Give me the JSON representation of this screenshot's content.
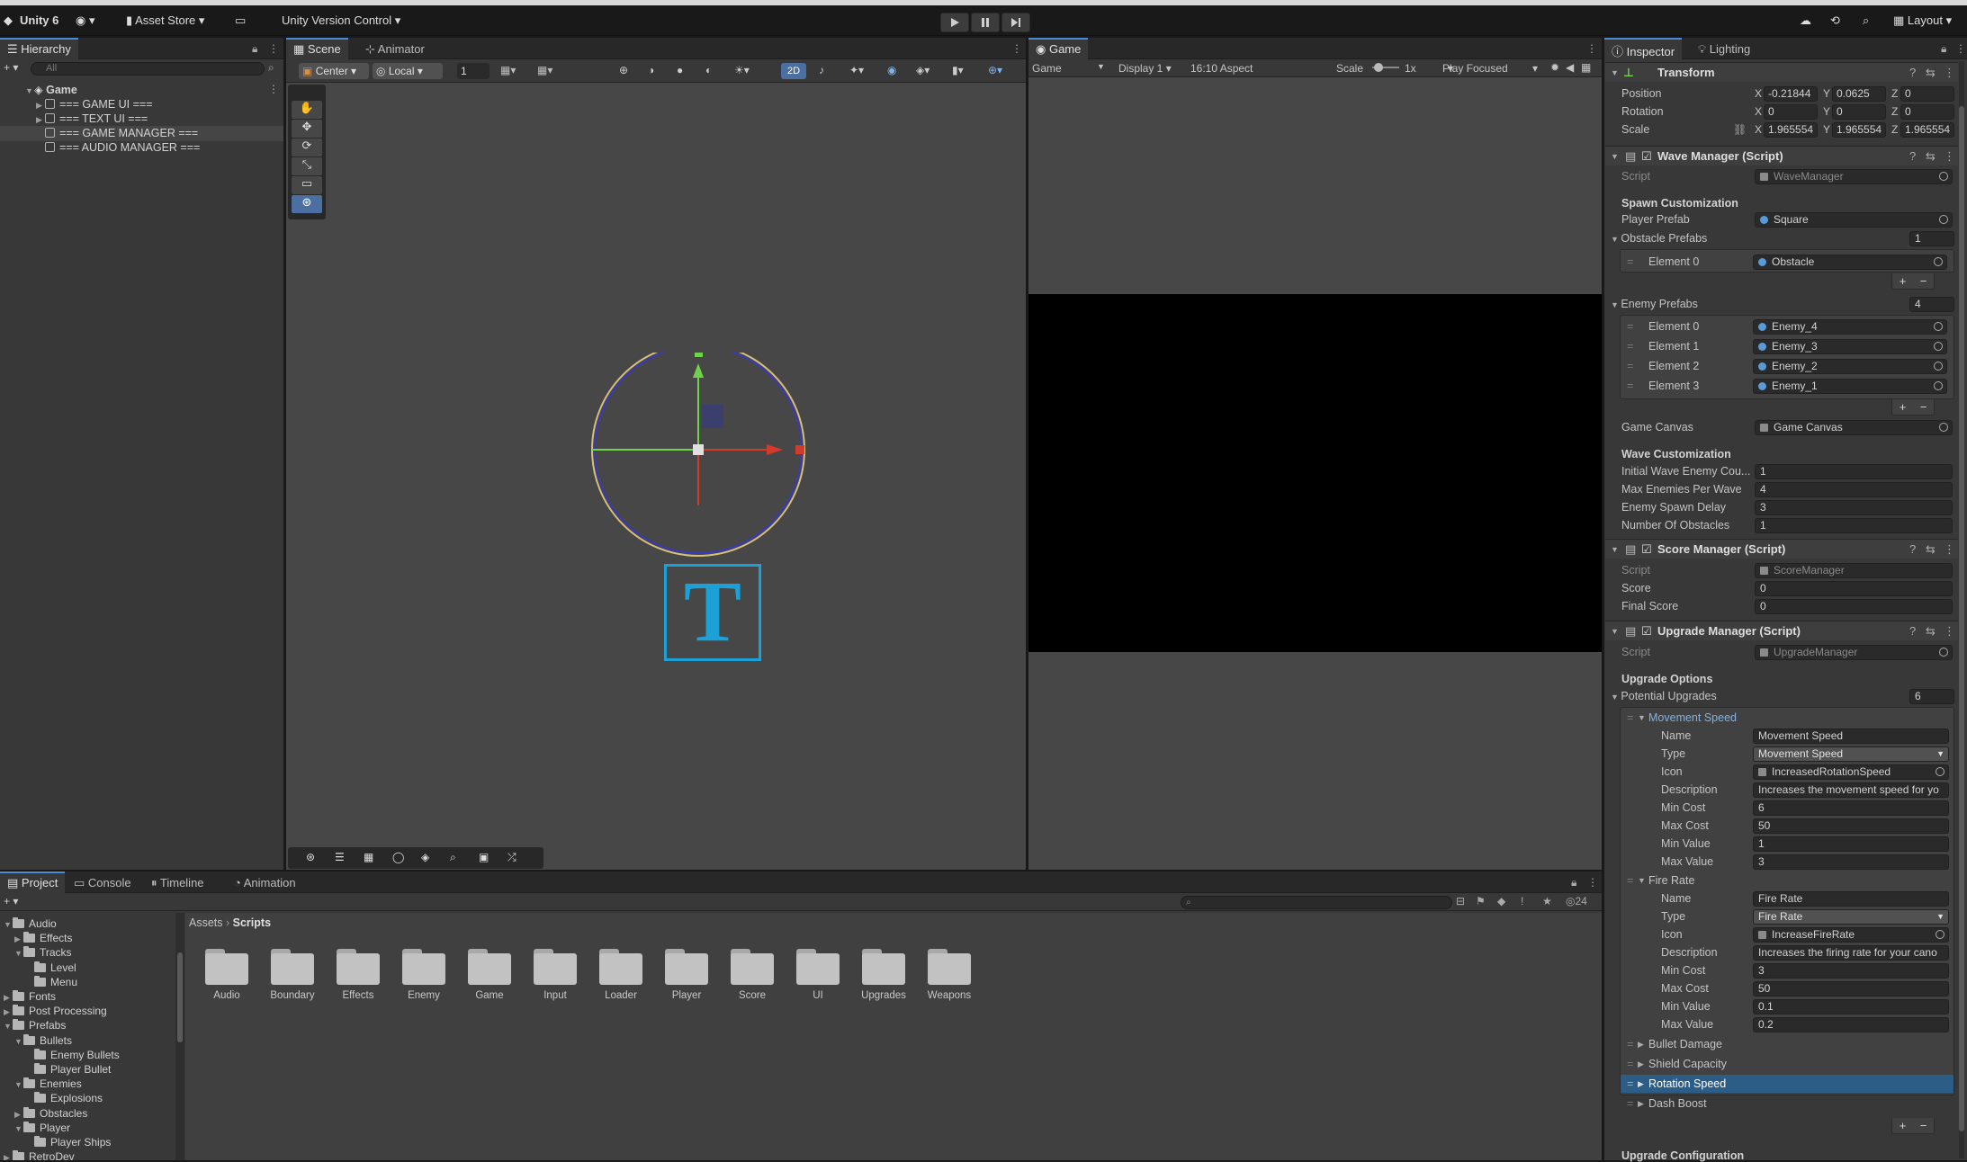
{
  "topbar": {
    "app": "Unity 6",
    "asset_store": "Asset Store",
    "version_control": "Unity Version Control",
    "layout": "Layout"
  },
  "hierarchy": {
    "tab": "Hierarchy",
    "search_placeholder": "All",
    "scene": "Game",
    "items": [
      "=== GAME UI ===",
      "=== TEXT UI ===",
      "=== GAME MANAGER ===",
      "=== AUDIO MANAGER ==="
    ]
  },
  "scene_view": {
    "tabs": [
      "Scene",
      "Animator"
    ],
    "pivot": "Center",
    "space": "Local",
    "grid_value": "1",
    "mode_2d": "2D",
    "text_tool_glyph": "T"
  },
  "game_view": {
    "tab": "Game",
    "display_mode": "Game",
    "display": "Display 1",
    "aspect": "16:10 Aspect",
    "scale_label": "Scale",
    "scale_value": "1x",
    "play_mode": "Play Focused"
  },
  "bottom": {
    "tabs": [
      "Project",
      "Console",
      "Timeline",
      "Animation"
    ],
    "breadcrumb": [
      "Assets",
      "Scripts"
    ],
    "hidden_count": "24",
    "tree": [
      {
        "label": "Audio",
        "depth": 1,
        "open": true
      },
      {
        "label": "Effects",
        "depth": 2,
        "open": false
      },
      {
        "label": "Tracks",
        "depth": 2,
        "open": true
      },
      {
        "label": "Level",
        "depth": 3,
        "open": false
      },
      {
        "label": "Menu",
        "depth": 3,
        "open": false
      },
      {
        "label": "Fonts",
        "depth": 1,
        "open": false
      },
      {
        "label": "Post Processing",
        "depth": 1,
        "open": false
      },
      {
        "label": "Prefabs",
        "depth": 1,
        "open": true
      },
      {
        "label": "Bullets",
        "depth": 2,
        "open": true
      },
      {
        "label": "Enemy Bullets",
        "depth": 3,
        "open": false
      },
      {
        "label": "Player Bullet",
        "depth": 3,
        "open": false
      },
      {
        "label": "Enemies",
        "depth": 2,
        "open": true
      },
      {
        "label": "Explosions",
        "depth": 3,
        "open": false
      },
      {
        "label": "Obstacles",
        "depth": 2,
        "open": false
      },
      {
        "label": "Player",
        "depth": 2,
        "open": true
      },
      {
        "label": "Player Ships",
        "depth": 3,
        "open": false
      },
      {
        "label": "RetroDev",
        "depth": 1,
        "open": false
      }
    ],
    "folders": [
      "Audio",
      "Boundary",
      "Effects",
      "Enemy",
      "Game",
      "Input",
      "Loader",
      "Player",
      "Score",
      "UI",
      "Upgrades",
      "Weapons"
    ]
  },
  "inspector": {
    "tabs": [
      "Inspector",
      "Lighting"
    ],
    "transform": {
      "title": "Transform",
      "position_label": "Position",
      "position": [
        "-0.21844",
        "0.0625",
        "0"
      ],
      "rotation_label": "Rotation",
      "rotation": [
        "0",
        "0",
        "0"
      ],
      "scale_label": "Scale",
      "scale": [
        "1.965554",
        "1.965554",
        "1.965554"
      ]
    },
    "wave": {
      "title": "Wave Manager (Script)",
      "script_label": "Script",
      "script": "WaveManager",
      "spawn_header": "Spawn Customization",
      "player_prefab_label": "Player Prefab",
      "player_prefab": "Square",
      "obstacle_label": "Obstacle Prefabs",
      "obstacle_count": "1",
      "obstacles": [
        {
          "label": "Element 0",
          "value": "Obstacle"
        }
      ],
      "enemy_label": "Enemy Prefabs",
      "enemy_count": "4",
      "enemies": [
        {
          "label": "Element 0",
          "value": "Enemy_4"
        },
        {
          "label": "Element 1",
          "value": "Enemy_3"
        },
        {
          "label": "Element 2",
          "value": "Enemy_2"
        },
        {
          "label": "Element 3",
          "value": "Enemy_1"
        }
      ],
      "canvas_label": "Game Canvas",
      "canvas": "Game Canvas",
      "wave_header": "Wave Customization",
      "fields": [
        {
          "label": "Initial Wave Enemy Cou...",
          "value": "1"
        },
        {
          "label": "Max Enemies Per Wave",
          "value": "4"
        },
        {
          "label": "Enemy Spawn Delay",
          "value": "3"
        },
        {
          "label": "Number Of Obstacles",
          "value": "1"
        }
      ]
    },
    "score": {
      "title": "Score Manager (Script)",
      "script_label": "Script",
      "script": "ScoreManager",
      "score_label": "Score",
      "score": "0",
      "final_label": "Final Score",
      "final": "0"
    },
    "upgrade": {
      "title": "Upgrade Manager (Script)",
      "script_label": "Script",
      "script": "UpgradeManager",
      "options_header": "Upgrade Options",
      "potential_label": "Potential Upgrades",
      "potential_count": "6",
      "movement": {
        "title": "Movement Speed",
        "name_label": "Name",
        "name": "Movement Speed",
        "type_label": "Type",
        "type": "Movement Speed",
        "icon_label": "Icon",
        "icon": "IncreasedRotationSpeed",
        "desc_label": "Description",
        "desc": "Increases the movement speed for yo",
        "mincost_label": "Min Cost",
        "mincost": "6",
        "maxcost_label": "Max Cost",
        "maxcost": "50",
        "minval_label": "Min Value",
        "minval": "1",
        "maxval_label": "Max Value",
        "maxval": "3"
      },
      "fire": {
        "title": "Fire Rate",
        "name_label": "Name",
        "name": "Fire Rate",
        "type_label": "Type",
        "type": "Fire Rate",
        "icon_label": "Icon",
        "icon": "IncreaseFireRate",
        "desc_label": "Description",
        "desc": "Increases the firing rate for your cano",
        "mincost_label": "Min Cost",
        "mincost": "3",
        "maxcost_label": "Max Cost",
        "maxcost": "50",
        "minval_label": "Min Value",
        "minval": "0.1",
        "maxval_label": "Max Value",
        "maxval": "0.2"
      },
      "collapsed": [
        "Bullet Damage",
        "Shield Capacity",
        "Rotation Speed",
        "Dash Boost"
      ],
      "config_header": "Upgrade Configuration"
    }
  },
  "colors": {
    "accent": "#4d8ad8",
    "selection": "#2c5d87",
    "panel": "#383838",
    "field": "#2a2a2a"
  }
}
